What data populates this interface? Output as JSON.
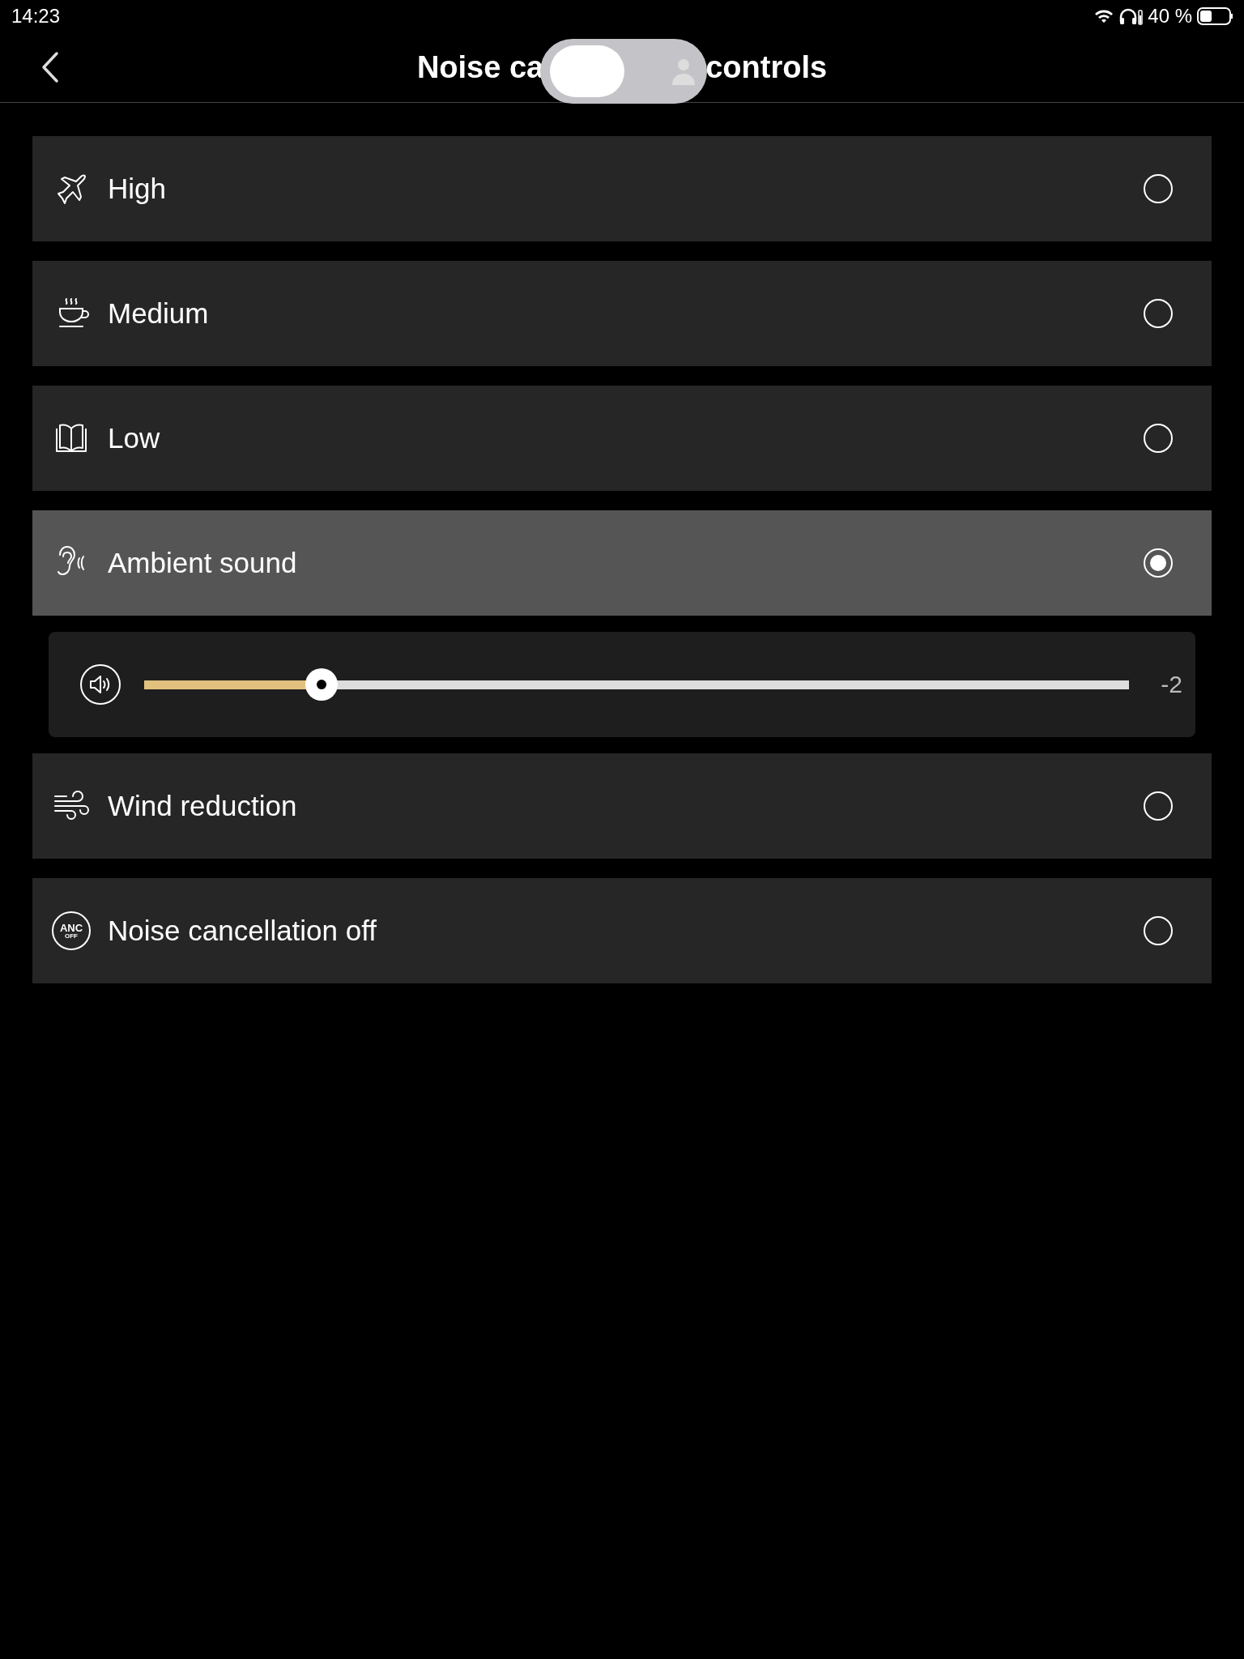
{
  "status_bar": {
    "time": "14:23",
    "battery": "40 %"
  },
  "header": {
    "title_start": "Noise ca",
    "title_end": "controls"
  },
  "modes": [
    {
      "kind": "plane",
      "label": "High",
      "selected": false
    },
    {
      "kind": "cup",
      "label": "Medium",
      "selected": false
    },
    {
      "kind": "book",
      "label": "Low",
      "selected": false
    },
    {
      "kind": "ear",
      "label": "Ambient sound",
      "selected": true,
      "slider": {
        "level": 0.18,
        "reading": "-2"
      }
    },
    {
      "kind": "wind",
      "label": "Wind reduction",
      "selected": false
    },
    {
      "kind": "anc",
      "label": "Noise cancellation off",
      "selected": false,
      "badge": [
        "ANC",
        "OFF"
      ]
    }
  ]
}
